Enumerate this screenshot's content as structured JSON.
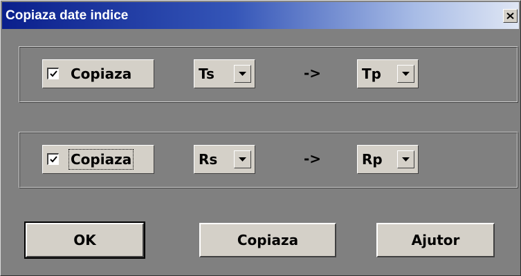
{
  "window": {
    "title": "Copiaza date indice",
    "close_icon": "close-icon"
  },
  "rows": [
    {
      "checkbox_label": "Copiaza",
      "checked": true,
      "source_value": "Ts",
      "arrow": "->",
      "target_value": "Tp"
    },
    {
      "checkbox_label": "Copiaza",
      "checked": true,
      "source_value": "Rs",
      "arrow": "->",
      "target_value": "Rp"
    }
  ],
  "buttons": {
    "ok": "OK",
    "copy": "Copiaza",
    "help": "Ajutor"
  },
  "colors": {
    "face": "#d4d0c8",
    "background": "#808080",
    "title_start": "#0a1f8c",
    "title_end": "#dfe6f4"
  }
}
